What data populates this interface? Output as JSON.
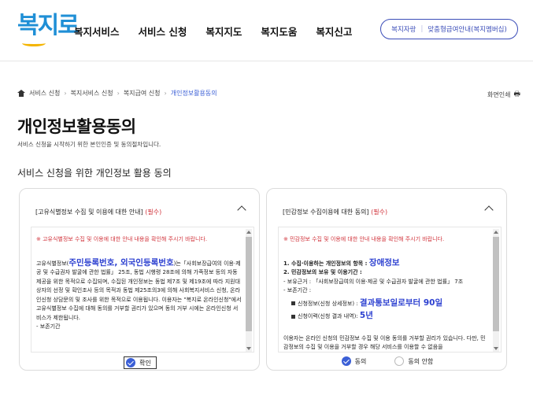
{
  "header": {
    "logo_text": "복지로",
    "nav": [
      "복지서비스",
      "서비스 신청",
      "복지지도",
      "복지도움",
      "복지신고"
    ],
    "util_left": "복지자랑",
    "util_right": "맞춤형급여안내(복지멤버십)"
  },
  "breadcrumb": {
    "items": [
      "서비스 신청",
      "복지서비스 신청",
      "복지급여 신청"
    ],
    "current": "개인정보활용동의",
    "print_label": "화면인쇄"
  },
  "page": {
    "title": "개인정보활용동의",
    "subtitle": "서비스 신청을 시작하기 위한 본인인증 및 동의절차입니다.",
    "section_title": "서비스 신청을 위한 개인정보 활용 동의"
  },
  "left_card": {
    "head": "[고유식별정보 수집 및 이용에 대한 안내]",
    "required": "(필수)",
    "notice": "※ 고유식별정보 수집 및 이용에 대한 안내 내용을 확인해 주시기 바랍니다.",
    "p1_pre": "고유식별정보(",
    "p1_big": "주민등록번호, 외국인등록번호",
    "p1_post": ")는「사회보장급여의 이용·제공 및 수급권자 발굴에 관한 법률」 25조, 동법 시행령 28조에 의해 가족정보 등의 자동 제공을 위한 목적으로 수집되며, 수집된 개인정보는 동법 제7조 및 제19조에 따라 지원대상자의 선정 및 확인조사 등의 목적과 동법 제25조의3에 의해 사회복지서비스 신청, 온라인신청 상담문의 및 조사를 위한 목적으로 이용됩니다. 이용자는 \"복지로 온라인신청\"에서 고유식별정보 수집에 대해 동의를 거부할 권리가 있으며 동의 거부 시에는 온라인신청 서비스가 제한됩니다.",
    "p2": "- 보존기간",
    "confirm": "확인"
  },
  "right_card": {
    "head": "[민감정보 수집이용에 대한 동의]",
    "required": "(필수)",
    "notice": "※ 민감정보 수집 및 이용에 대한 안내 내용을 확인해 주시기 바랍니다.",
    "item1_label": "1. 수집·이용하는 개인정보의 항목 :",
    "item1_big": "장애정보",
    "item2_label": "2. 민감정보의 보유 및 이용기간 :",
    "item2_basis": "- 보유근거 : 「사회보장급여의 이용·제공 및 수급권자 발굴에 관한 법률」 7조",
    "item2_period": "- 보존기간 :",
    "row1_label": "신청정보(신청 상세정보) :",
    "row1_big": "결과통보일로부터 90일",
    "row2_label": "신청이력(신청 결과 내역):",
    "row2_big": "5년",
    "footer": "이용자는 온라인 신청의 민감정보 수집 및 이용 동의를 거부할 권리가 있습니다. 다만, 민감정보의 수집 및 이용을 거부할 경우 해당 서비스를 이용할 수 없음을",
    "agree": "동의",
    "disagree": "동의 안함"
  },
  "colors": {
    "accent": "#3b5fd6",
    "required": "#d1343c",
    "highlight": "#2b3fd0"
  }
}
